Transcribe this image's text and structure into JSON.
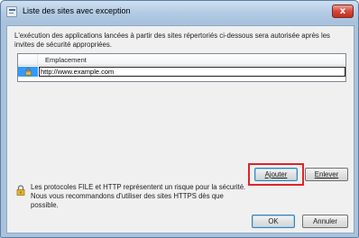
{
  "window": {
    "title": "Liste des sites avec exception",
    "close_glyph": "x",
    "title_icon": "java-window-icon"
  },
  "description": "L'exécution des applications lancées à partir des sites répertoriés ci-dessous sera autorisée après les invites de sécurité appropriées.",
  "site_list": {
    "column_header": "Emplacement",
    "rows": [
      {
        "icon": "lock-icon",
        "location": "http://www.example.com",
        "selected": true,
        "editing": true
      }
    ]
  },
  "buttons": {
    "add": "Ajouter",
    "remove": "Enlever",
    "ok": "OK",
    "cancel": "Annuler"
  },
  "warning": {
    "icon": "lock-icon",
    "line1": "Les protocoles FILE et HTTP représentent un risque pour la sécurité.",
    "line2": "Nous vous recommandons d'utiliser des sites HTTPS dès que possible."
  },
  "colors": {
    "selection": "#3399ff",
    "highlight_box": "#e0242b",
    "close_button": "#d5473a",
    "title_bar": "#b3cbe4"
  }
}
